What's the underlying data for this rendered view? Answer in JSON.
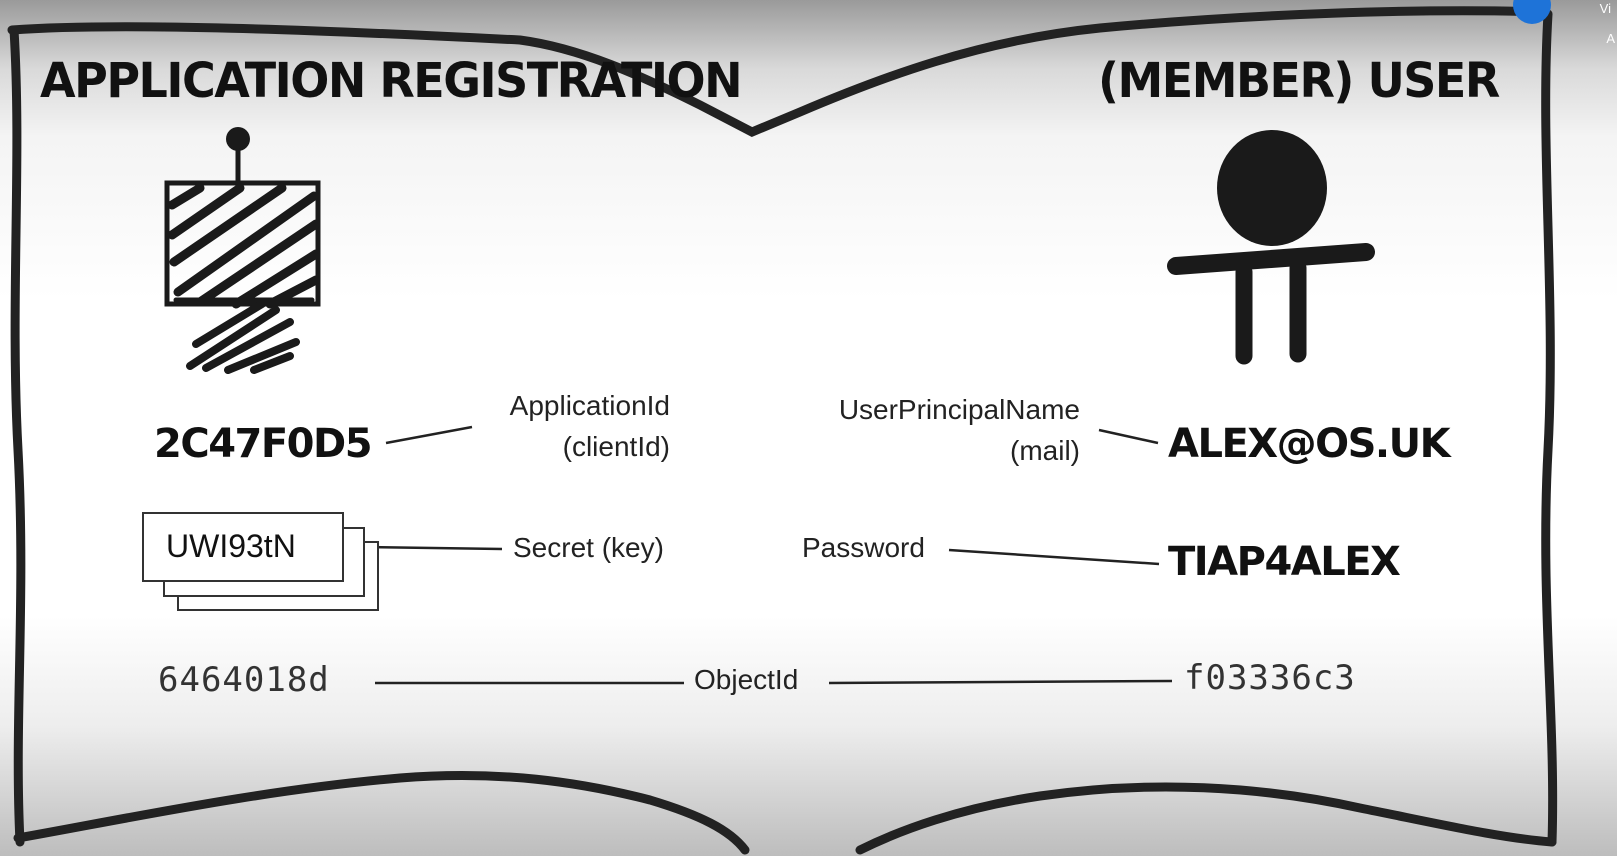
{
  "left_panel": {
    "title": "APPLICATION REGISTRATION",
    "client_id_value": "2C47F0D5",
    "client_id_label_line1": "ApplicationId",
    "client_id_label_line2": "(clientId)",
    "secret_value": "UWI93tN",
    "secret_label": "Secret (key)",
    "object_id_value": "6464018d",
    "robot_icon": "robot-icon"
  },
  "right_panel": {
    "title": "(MEMBER) USER",
    "upn_label_line1": "UserPrincipalName",
    "upn_label_line2": "(mail)",
    "upn_value": "ALEX@OS.UK",
    "password_label": "Password",
    "password_value": "TIAP4ALEX",
    "object_id_value": "f03336c3",
    "person_icon": "person-icon"
  },
  "shared": {
    "object_id_label": "ObjectId"
  },
  "overlay": {
    "corner_text_top": "Vi",
    "corner_text_bottom": "A",
    "badge_color": "#1e73d8"
  }
}
